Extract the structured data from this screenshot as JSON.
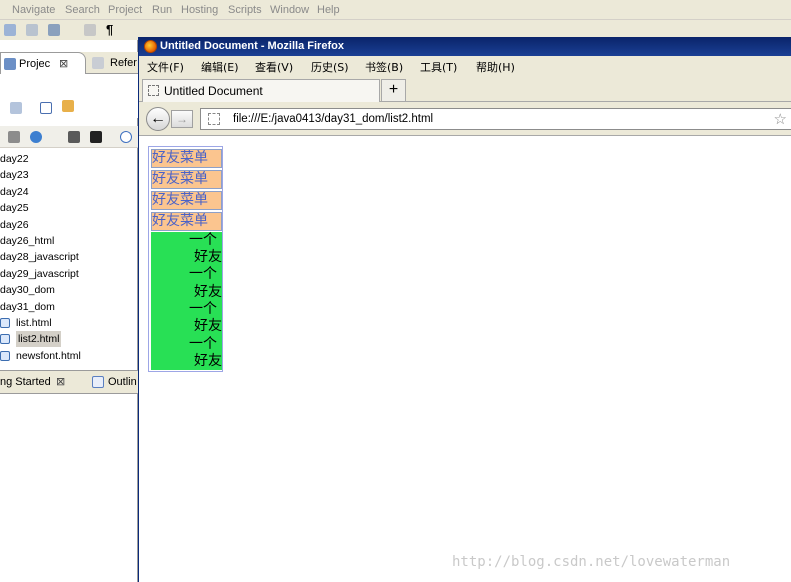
{
  "eclipse": {
    "menu": [
      "Navigate",
      "Search",
      "Project",
      "Run",
      "Hosting",
      "Scripts",
      "Window",
      "Help"
    ],
    "project_tab": "Projec",
    "reference_tab": "Refer",
    "tree": [
      {
        "label": "day22",
        "type": "folder"
      },
      {
        "label": "day23",
        "type": "folder"
      },
      {
        "label": "day24",
        "type": "folder"
      },
      {
        "label": "day25",
        "type": "folder"
      },
      {
        "label": "day26",
        "type": "folder"
      },
      {
        "label": "day26_html",
        "type": "folder"
      },
      {
        "label": "day28_javascript",
        "type": "folder"
      },
      {
        "label": "day29_javascript",
        "type": "folder"
      },
      {
        "label": "day30_dom",
        "type": "folder"
      },
      {
        "label": "day31_dom",
        "type": "folder"
      },
      {
        "label": "list.html",
        "type": "file"
      },
      {
        "label": "list2.html",
        "type": "file",
        "selected": true
      },
      {
        "label": "newsfont.html",
        "type": "file"
      }
    ],
    "getting_started_tab": "ng Started",
    "outline_tab": "Outlin"
  },
  "firefox": {
    "window_title": "Untitled Document - Mozilla Firefox",
    "menu": [
      "文件(F)",
      "编辑(E)",
      "查看(V)",
      "历史(S)",
      "书签(B)",
      "工具(T)",
      "帮助(H)"
    ],
    "tab_title": "Untitled Document",
    "new_tab_label": "+",
    "url": "file:///E:/java0413/day31_dom/list2.html",
    "back_glyph": "←",
    "forward_glyph": "→"
  },
  "page": {
    "menu_titles": [
      "好友菜单",
      "好友菜单",
      "好友菜单",
      "好友菜单"
    ],
    "friend_lines": [
      "一个",
      "好友",
      "一个",
      "好友",
      "一个",
      "好友",
      "一个",
      "好友"
    ]
  },
  "watermark": "http://blog.csdn.net/lovewaterman",
  "colors": {
    "menu_title_bg": "#fbc58f",
    "menu_title_text": "#4a62c8",
    "friends_bg": "#28e055",
    "titlebar": "#0a246a"
  }
}
